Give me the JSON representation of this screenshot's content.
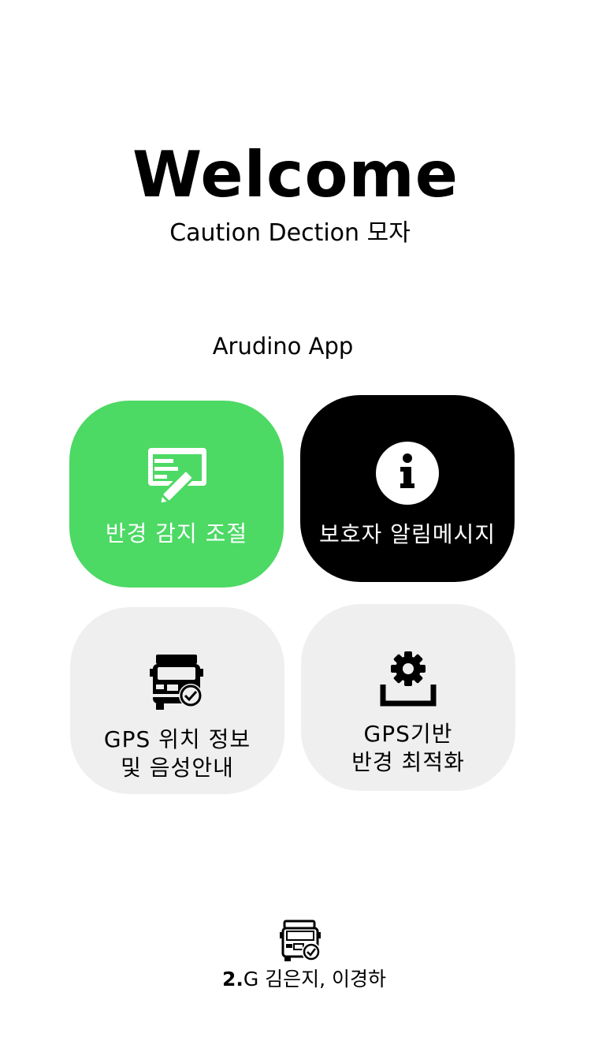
{
  "header": {
    "title": "Welcome",
    "subtitle": "Caution Dection 모자"
  },
  "app_label": "Arudino App",
  "tiles": [
    {
      "label_line1": "반경 감지 조절",
      "icon": "form-pen-icon",
      "color": "#4cd964"
    },
    {
      "label_line1": "보호자 알림메시지",
      "icon": "info-icon",
      "color": "#000000"
    },
    {
      "label_line1": "GPS 위치 정보",
      "label_line2": "및 음성안내",
      "icon": "truck-check-icon",
      "color": "#efefef"
    },
    {
      "label_line1": "GPS기반",
      "label_line2": "반경 최적화",
      "icon": "gear-upload-icon",
      "color": "#efefef"
    }
  ],
  "footer": {
    "team_number": "2.",
    "team_names": "G 김은지, 이경하",
    "icon": "truck-check-icon"
  }
}
